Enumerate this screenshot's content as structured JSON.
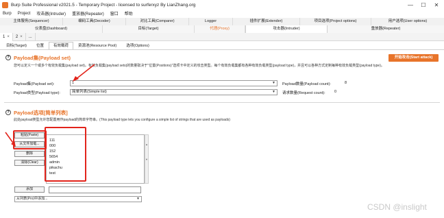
{
  "window": {
    "title": "Burp Suite Professional v2021.5 - Temporary Project - licensed to surferxyz By LianZhang.org",
    "minimize": "—",
    "maximize": "☐",
    "close": "✕"
  },
  "menu": [
    "Burp",
    "Project",
    "攻击器(Intruder)",
    "重放器(Repeater)",
    "窗口",
    "帮助"
  ],
  "main_tabs": {
    "row1": [
      "主体服务(Sequencer)",
      "编码工具(Decoder)",
      "对比工具(Comparer)",
      "Logger",
      "插件扩展(Extender)",
      "项目选项(Project options)",
      "用户选项(User options)"
    ],
    "row2": [
      "仪表盘(Dashboard)",
      "目标(Target)",
      "代理(Proxy)",
      "攻击器(Intruder)",
      "重放器(Repeater)"
    ]
  },
  "number_tabs": [
    {
      "label": "1",
      "close": "×"
    },
    {
      "label": "2",
      "close": "×"
    },
    {
      "label": "...",
      "close": ""
    }
  ],
  "sub_tabs": [
    "目标(Target)",
    "位置",
    "有效载荷",
    "资源池(Resource Pool)",
    "选项(Options)"
  ],
  "payload_sets": {
    "title": "Payload集(Payload set)",
    "description": "您可以定义一个或多个有效负载集(payload set)。有效负载集(payload sets)的数量取决于\"位置(Positions)\"选项卡中定义的攻击类型。每个有效负载集都有各种有效负载类型(payload type)，并且可以各种方式定制每种有效负载类型(payload type)。",
    "start_attack": "开始攻击(Start attack)",
    "set_label": "Payload集(Payload set):",
    "set_value": "1",
    "type_label": "Payload类型(Payload type):",
    "type_value": "简单列表(Simple list)",
    "count_label": "Payload数量(Payload count):",
    "count_value": "8",
    "request_label": "请求数量(Request count):",
    "request_value": "0"
  },
  "payload_options": {
    "title": "Payload选项[简单列表]",
    "description": "此处payload类型允许您配置用作payload的简单字符串。(This payload type lets you configure a simple list of strings that are used as payloads)",
    "buttons": {
      "paste": "粘贴(Paste)",
      "load": "从文件加载...",
      "remove": "删除",
      "clear": "清除(Clear)",
      "add": "添加"
    },
    "list": [
      "111",
      "000",
      "152",
      "5654",
      "admin",
      "pikachu",
      "test"
    ],
    "add_from_list": "从列表(Pro)中添加..."
  },
  "watermark": "CSDN @inslight"
}
